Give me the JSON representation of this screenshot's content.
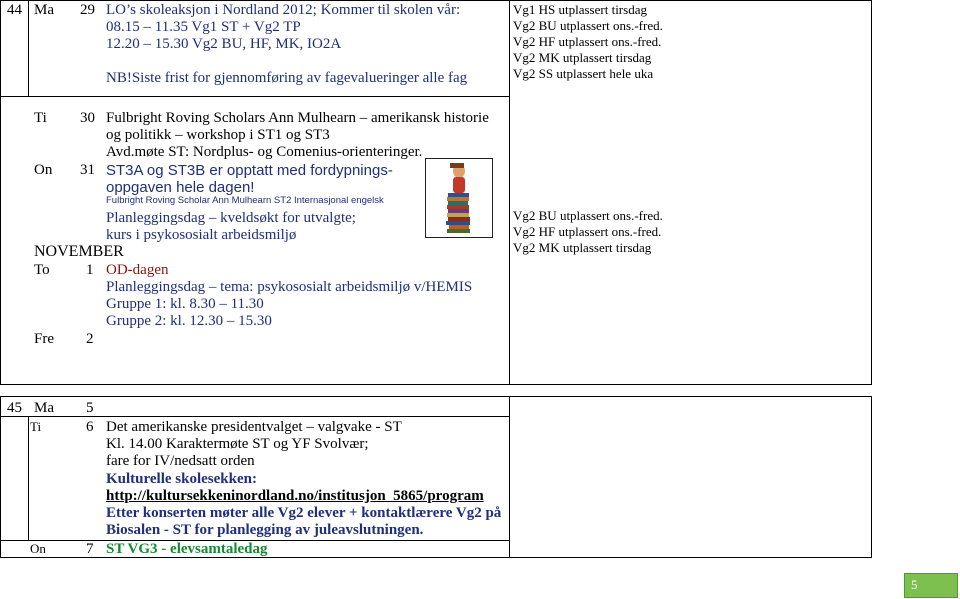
{
  "week44": {
    "week": "44",
    "rows": [
      {
        "day": "Ma",
        "date": "29",
        "lines": [
          "LO’s skoleaksjon i Nordland 2012; Kommer til skolen vår:",
          "08.15 – 11.35 Vg1 ST + Vg2 TP",
          "12.20 – 15.30 Vg2 BU, HF, MK, IO2A"
        ],
        "note": "NB!Siste frist for gjennomføring av fagevalueringer alle fag"
      },
      {
        "day": "Ti",
        "date": "30",
        "lines": [
          "Fulbright Roving Scholars Ann Mulhearn – amerikansk historie",
          "og politikk – workshop i ST1 og ST3",
          "Avd.møte ST: Nordplus- og Comenius-orienteringer."
        ]
      },
      {
        "day": "On",
        "date": "31",
        "highlight": [
          "ST3A og ST3B er opptatt med fordypnings-",
          "oppgaven hele dagen!"
        ],
        "small": "Fulbright Roving Scholar Ann Mulhearn ST2 Internasjonal engelsk",
        "lines": [
          "Planleggingsdag – kveldsøkt for utvalgte;",
          "kurs i psykososialt arbeidsmiljø"
        ]
      }
    ],
    "month": "NOVEMBER",
    "rows2": [
      {
        "day": "To",
        "date": "1",
        "title": "OD-dagen",
        "lines": [
          "Planleggingsdag – tema: psykososialt arbeidsmiljø v/HEMIS",
          "Gruppe 1: kl.   8.30 – 11.30",
          "Gruppe 2: kl. 12.30 – 15.30"
        ]
      },
      {
        "day": "Fre",
        "date": "2"
      }
    ],
    "right1": [
      "Vg1 HS utplassert tirsdag",
      "Vg2 BU utplassert ons.-fred.",
      "Vg2 HF utplassert ons.-fred.",
      "Vg2 MK utplassert tirsdag",
      "Vg2 SS utplassert hele uka"
    ],
    "right2": [
      "Vg2 BU utplassert ons.-fred.",
      "Vg2 HF utplassert ons.-fred.",
      "Vg2 MK utplassert tirsdag"
    ]
  },
  "week45": {
    "week": "45",
    "mon": {
      "day": "Ma",
      "date": "5"
    },
    "tue": {
      "day": "Ti",
      "date": "6",
      "lines": [
        "Det amerikanske presidentvalget – valgvake - ST",
        "Kl. 14.00 Karaktermøte ST og YF Svolvær;",
        "fare for IV/nedsatt orden"
      ],
      "blue_heading": "Kulturelle skolesekken:",
      "link": "http://kultursekkeninordland.no/institusjon_5865/program",
      "blue_lines": [
        "Etter konserten møter alle Vg2 elever + kontaktlærere Vg2 på",
        "Biosalen - ST for planlegging av juleavslutningen."
      ]
    },
    "wed": {
      "day": "On",
      "date": "7",
      "title": "ST VG3 - elevsamtaledag"
    }
  },
  "footer": {
    "page_number": "5"
  }
}
